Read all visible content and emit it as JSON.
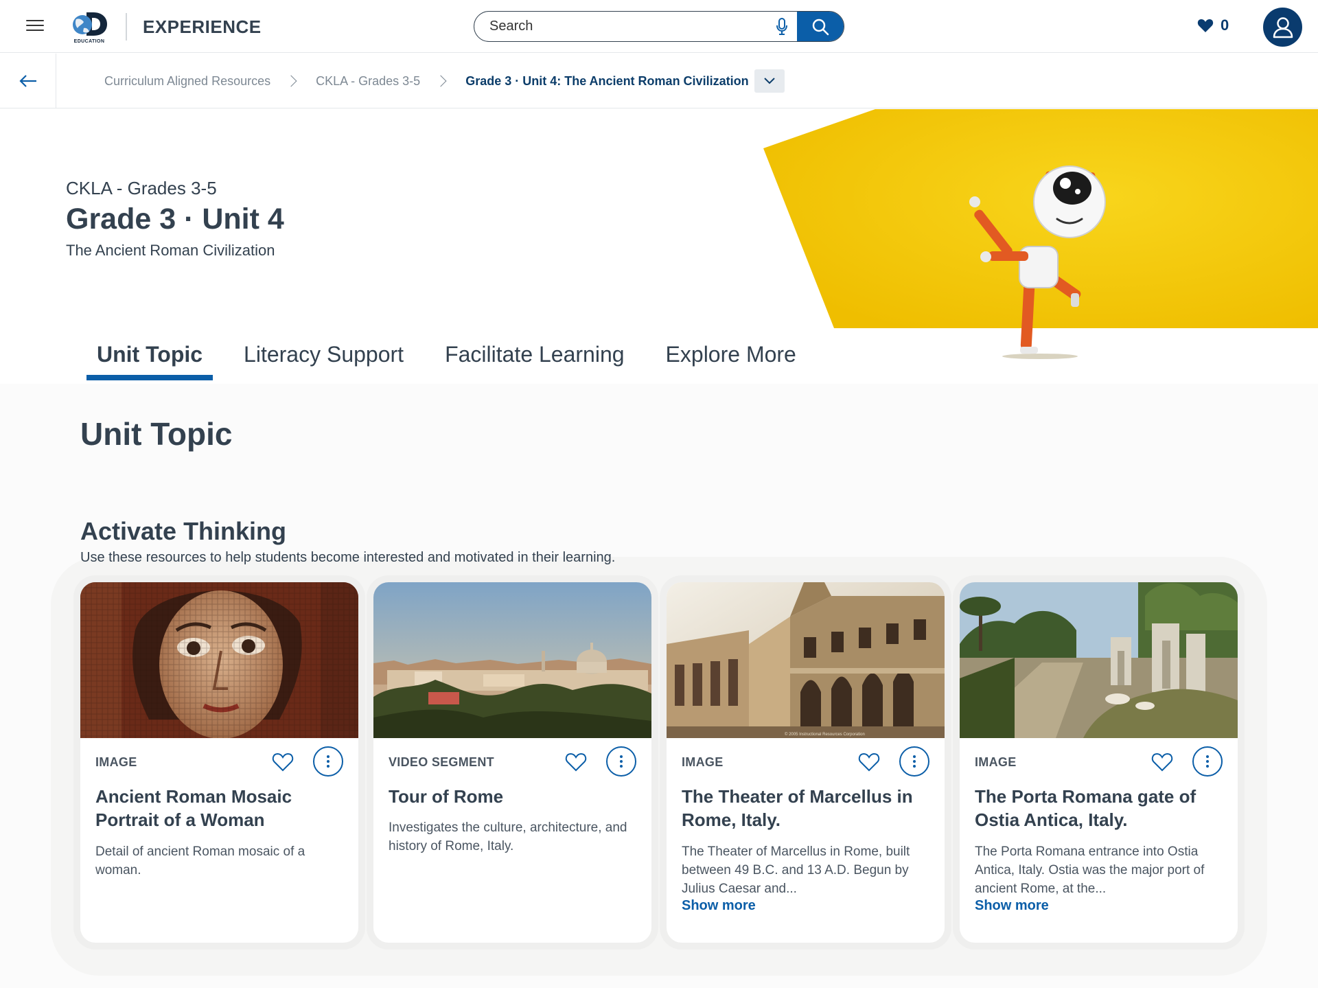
{
  "header": {
    "brand": "EXPERIENCE",
    "logo_caption": "EDUCATION",
    "search_placeholder": "Search",
    "favorites_count": "0"
  },
  "breadcrumb": {
    "items": [
      "Curriculum Aligned Resources",
      "CKLA - Grades 3-5"
    ],
    "current": "Grade 3 · Unit 4: The Ancient Roman Civilization"
  },
  "hero": {
    "series": "CKLA - Grades 3-5",
    "title": "Grade 3 · Unit 4",
    "subtitle": "The Ancient Roman Civilization"
  },
  "tabs": [
    {
      "label": "Unit Topic",
      "active": true
    },
    {
      "label": "Literacy Support",
      "active": false
    },
    {
      "label": "Facilitate Learning",
      "active": false
    },
    {
      "label": "Explore More",
      "active": false
    }
  ],
  "main": {
    "section_title": "Unit Topic",
    "group_title": "Activate Thinking",
    "group_desc": "Use these resources to help students become interested and motivated in their learning.",
    "cards": [
      {
        "type": "IMAGE",
        "title": "Ancient Roman Mosaic Portrait of a Woman",
        "desc": "Detail of ancient Roman mosaic of a woman.",
        "show_more": ""
      },
      {
        "type": "VIDEO SEGMENT",
        "title": "Tour of Rome",
        "desc": "Investigates the culture, architecture, and history of Rome, Italy.",
        "show_more": ""
      },
      {
        "type": "IMAGE",
        "title": "The Theater of Marcellus in Rome, Italy.",
        "desc": "The Theater of Marcellus in Rome, built between 49 B.C. and 13 A.D. Begun by Julius Caesar and...",
        "show_more": "Show more",
        "watermark": "© 2005 Instructional Resources Corporation"
      },
      {
        "type": "IMAGE",
        "title": "The Porta Romana gate of Ostia Antica, Italy.",
        "desc": "The Porta Romana entrance into Ostia Antica, Italy. Ostia was the major port of ancient Rome, at the...",
        "show_more": "Show more"
      }
    ]
  },
  "colors": {
    "accent": "#0b5ea8",
    "navy": "#0a3b6e",
    "text": "#33414f",
    "hero_yellow": "#f5c400"
  }
}
